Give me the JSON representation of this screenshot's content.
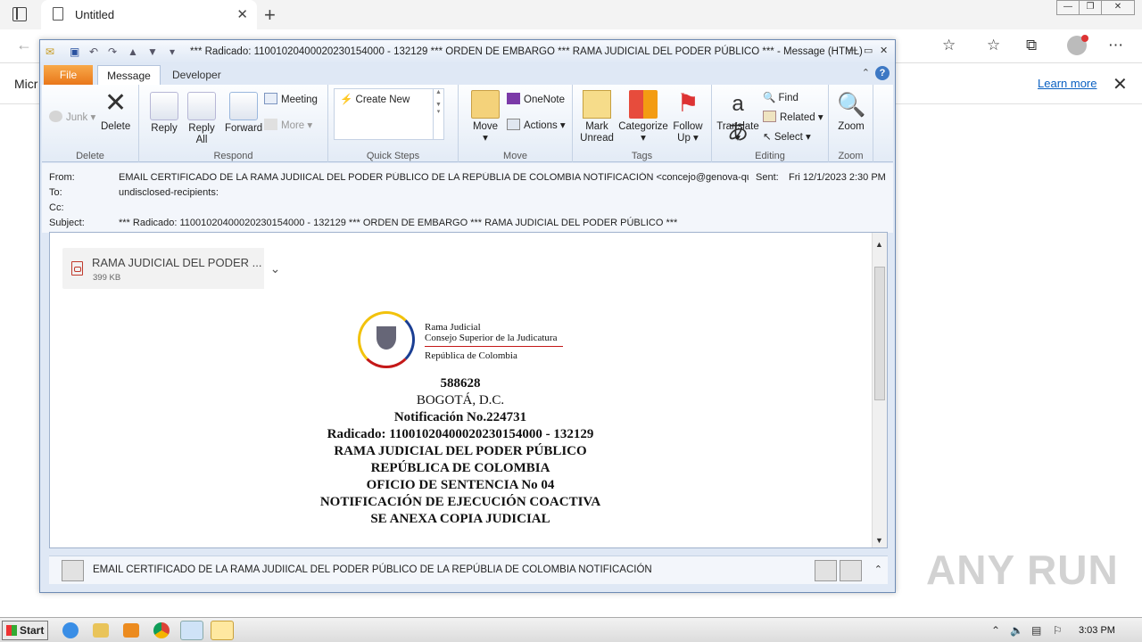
{
  "browser": {
    "tab_title": "Untitled",
    "infobar_text": "Micr",
    "learn_more": "Learn more"
  },
  "outlook": {
    "title": "*** Radicado: 11001020400020230154000 - 132129 *** ORDEN DE EMBARGO *** RAMA JUDICIAL DEL PODER PÚBLICO *** - Message (HTML)",
    "tabs": {
      "file": "File",
      "message": "Message",
      "developer": "Developer"
    },
    "ribbon": {
      "delete": {
        "junk": "Junk",
        "delete": "Delete",
        "label": "Delete"
      },
      "respond": {
        "reply": "Reply",
        "reply_all_1": "Reply",
        "reply_all_2": "All",
        "forward": "Forward",
        "meeting": "Meeting",
        "more": "More",
        "label": "Respond"
      },
      "quick_steps": {
        "create_new": "Create New",
        "label": "Quick Steps"
      },
      "move": {
        "move": "Move",
        "onenote": "OneNote",
        "actions": "Actions",
        "label": "Move"
      },
      "tags": {
        "mark_1": "Mark",
        "mark_2": "Unread",
        "categorize": "Categorize",
        "follow_1": "Follow",
        "follow_2": "Up",
        "label": "Tags"
      },
      "editing": {
        "translate": "Translate",
        "find": "Find",
        "related": "Related",
        "select": "Select",
        "label": "Editing"
      },
      "zoom": {
        "zoom": "Zoom",
        "label": "Zoom"
      }
    },
    "headers": {
      "from_label": "From:",
      "from_value": "EMAIL CERTIFICADO DE LA RAMA JUDIICAL DEL PODER PÚBLICO DE LA REPÚBLIA DE COLOMBIA NOTIFICACIÓN <concejo@genova-quindio.gov",
      "sent_label": "Sent:",
      "sent_value": "Fri 12/1/2023 2:30 PM",
      "to_label": "To:",
      "to_value": "undisclosed-recipients:",
      "cc_label": "Cc:",
      "subject_label": "Subject:",
      "subject_value": "*** Radicado: 11001020400020230154000 - 132129 *** ORDEN DE EMBARGO *** RAMA JUDICIAL DEL PODER PÚBLICO ***"
    },
    "attachment": {
      "name": "RAMA JUDICIAL DEL PODER ...",
      "size": "399 KB"
    },
    "logo": {
      "line1": "Rama Judicial",
      "line2": "Consejo Superior de la Judicatura",
      "line3": "República de Colombia"
    },
    "body_lines": [
      "588628",
      "BOGOTÁ, D.C.",
      "Notificación No.224731",
      "Radicado: 11001020400020230154000 - 132129",
      "RAMA JUDICIAL DEL PODER PÚBLICO",
      "REPÚBLICA DE COLOMBIA",
      "OFICIO DE SENTENCIA No 04",
      "NOTIFICACIÓN DE EJECUCIÓN COACTIVA",
      "SE ANEXA COPIA JUDICIAL"
    ],
    "people_pane": "EMAIL CERTIFICADO DE LA RAMA JUDIICAL DEL PODER PÚBLICO DE LA REPÚBLIA DE COLOMBIA NOTIFICACIÓN"
  },
  "watermark": "ANY RUN",
  "taskbar": {
    "start": "Start",
    "clock": "3:03 PM"
  }
}
